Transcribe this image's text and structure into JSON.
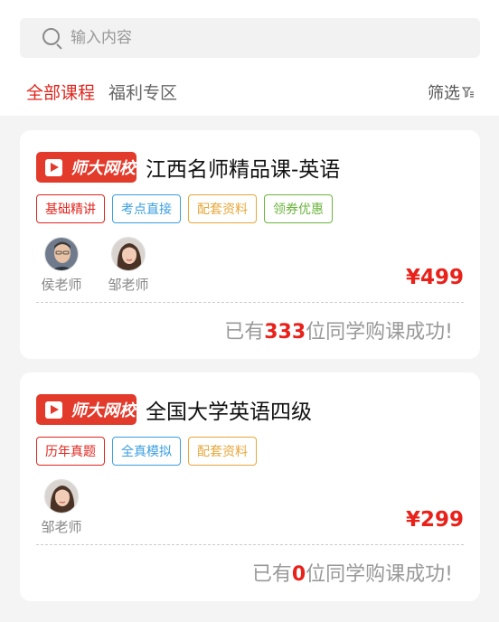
{
  "search": {
    "placeholder": "输入内容",
    "value": ""
  },
  "tabs": [
    {
      "label": "全部课程",
      "active": true
    },
    {
      "label": "福利专区",
      "active": false
    }
  ],
  "filter": {
    "label": "筛选"
  },
  "brand": {
    "logo_text": "师大网校",
    "color": "#e23a2b"
  },
  "courses": [
    {
      "title": "江西名师精品课-英语",
      "tags": [
        {
          "label": "基础精讲",
          "color": "#e0251d"
        },
        {
          "label": "考点直接",
          "color": "#3a9ee0"
        },
        {
          "label": "配套资料",
          "color": "#e6a63a"
        },
        {
          "label": "领券优惠",
          "color": "#6bb43c"
        }
      ],
      "teachers": [
        {
          "name": "侯老师"
        },
        {
          "name": "邹老师"
        }
      ],
      "price": "¥499",
      "purchase": {
        "prefix": "已有",
        "count": "333",
        "suffix": "位同学购课成功!"
      }
    },
    {
      "title": "全国大学英语四级",
      "tags": [
        {
          "label": "历年真题",
          "color": "#e0251d"
        },
        {
          "label": "全真模拟",
          "color": "#3a9ee0"
        },
        {
          "label": "配套资料",
          "color": "#e6a63a"
        }
      ],
      "teachers": [
        {
          "name": "邹老师"
        }
      ],
      "price": "¥299",
      "purchase": {
        "prefix": "已有",
        "count": "0",
        "suffix": "位同学购课成功!"
      }
    }
  ]
}
